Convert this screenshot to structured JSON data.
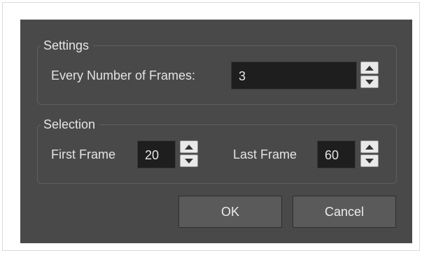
{
  "settings": {
    "title": "Settings",
    "every_label": "Every Number of Frames:",
    "every_value": "3"
  },
  "selection": {
    "title": "Selection",
    "first_label": "First Frame",
    "first_value": "20",
    "last_label": "Last Frame",
    "last_value": "60"
  },
  "buttons": {
    "ok": "OK",
    "cancel": "Cancel"
  },
  "icons": {
    "spin_up": "triangle-up-icon",
    "spin_down": "triangle-down-icon"
  },
  "colors": {
    "dialog_bg": "#494949",
    "field_bg": "#1e1e1e",
    "text": "#e3e3e3"
  }
}
